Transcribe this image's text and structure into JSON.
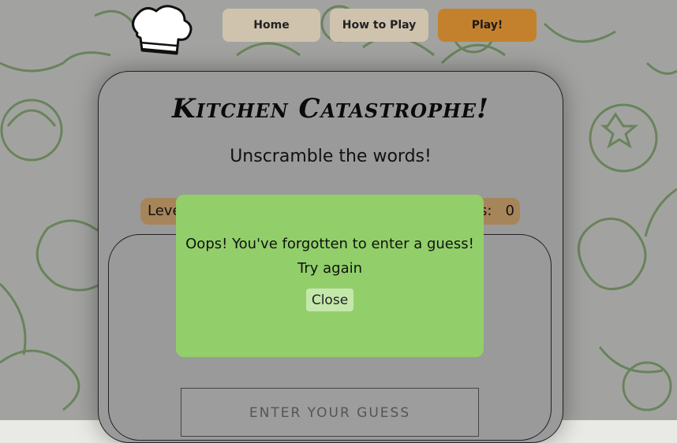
{
  "nav": {
    "home": "Home",
    "how_to_play": "How to Play",
    "play": "Play!"
  },
  "game": {
    "title": "Kitchen Catastrophe!",
    "subtitle": "Unscramble the words!",
    "stats_left": "Leve",
    "stats_right": "s:   0",
    "guess_placeholder": "ENTER YOUR GUESS"
  },
  "modal": {
    "line1": "Oops! You've forgotten to enter a guess!",
    "line2": "Try again",
    "close": "Close"
  },
  "colors": {
    "background": "#e9eae5",
    "pattern_stroke": "#8fb87a",
    "modal_green": "#92cf6a",
    "play_orange": "#c4812d",
    "nav_beige": "#cfc3ae"
  }
}
